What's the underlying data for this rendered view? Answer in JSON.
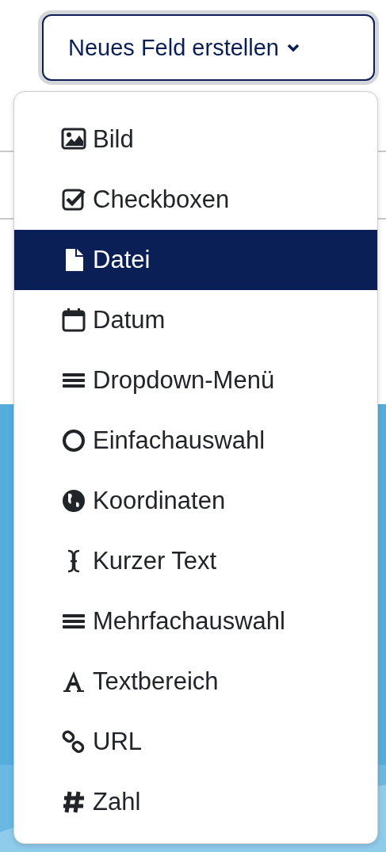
{
  "button": {
    "label": "Neues Feld erstellen",
    "expanded": true
  },
  "menu": [
    {
      "label": "Bild",
      "selected": false
    },
    {
      "label": "Checkboxen",
      "selected": false
    },
    {
      "label": "Datei",
      "selected": true
    },
    {
      "label": "Datum",
      "selected": false
    },
    {
      "label": "Dropdown-Menü",
      "selected": false
    },
    {
      "label": "Einfachauswahl",
      "selected": false
    },
    {
      "label": "Koordinaten",
      "selected": false
    },
    {
      "label": "Kurzer Text",
      "selected": false
    },
    {
      "label": "Mehrfachauswahl",
      "selected": false
    },
    {
      "label": "Textbereich",
      "selected": false
    },
    {
      "label": "URL",
      "selected": false
    },
    {
      "label": "Zahl",
      "selected": false
    }
  ]
}
